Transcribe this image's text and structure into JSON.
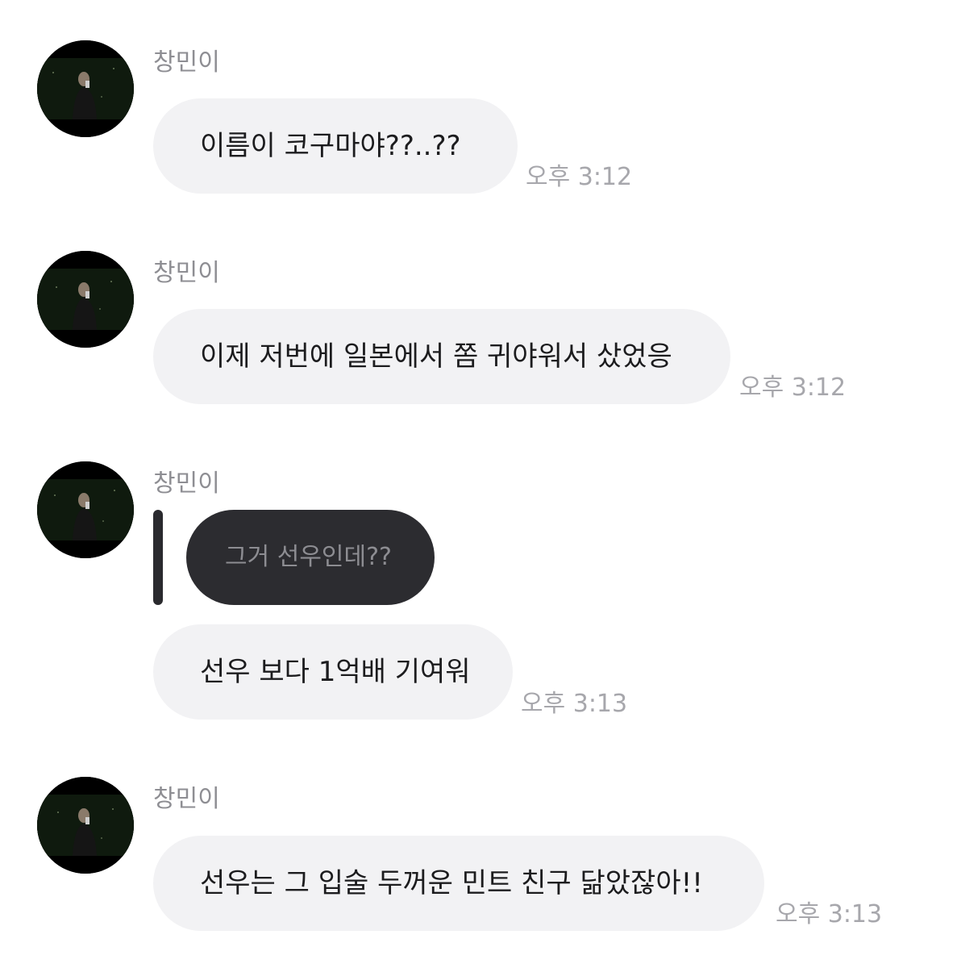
{
  "messages": [
    {
      "sender": "창민이",
      "text": "이름이 코구마야??..??",
      "time": "오후 3:12"
    },
    {
      "sender": "창민이",
      "text": "이제 저번에 일본에서 쫌 귀야워서 샀었응",
      "time": "오후 3:12"
    },
    {
      "sender": "창민이",
      "quoted_text": "그거 선우인데??",
      "text": "선우 보다 1억배 기여워",
      "time": "오후 3:13"
    },
    {
      "sender": "창민이",
      "text": "선우는 그 입술 두꺼운 민트 친구 닮았잖아!!",
      "time": "오후 3:13"
    }
  ],
  "colors": {
    "bubble_background": "#f2f2f4",
    "reply_bubble_background": "#2c2c30",
    "reply_bar": "#2a2a2e",
    "sender_text": "#8e8e93",
    "time_text": "#a7a7ac",
    "message_text": "#1c1c1e"
  },
  "icons": {
    "avatar": "profile-photo-avatar"
  }
}
